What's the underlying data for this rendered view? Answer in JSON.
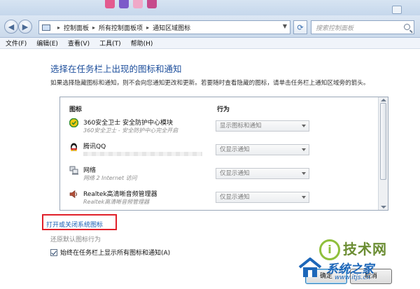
{
  "address_bar": {
    "breadcrumbs": [
      "控制面板",
      "所有控制面板项",
      "通知区域图标"
    ],
    "search_placeholder": "搜索控制面板"
  },
  "menu": [
    "文件(F)",
    "编辑(E)",
    "查看(V)",
    "工具(T)",
    "帮助(H)"
  ],
  "main": {
    "title": "选择在任务栏上出现的图标和通知",
    "description": "如果选择隐藏图标和通知，则不会向您通知更改和更新。若要随时查看隐藏的图标，请单击任务栏上通知区域旁的箭头。",
    "columns": {
      "icons": "图标",
      "behavior": "行为"
    },
    "rows": [
      {
        "name": "360安全卫士 安全防护中心模块",
        "sub": "360安全卫士 - 安全防护中心完全开启",
        "behavior": "显示图标和通知",
        "icon": "shield-icon"
      },
      {
        "name": "腾讯QQ",
        "sub": "",
        "behavior": "仅显示通知",
        "icon": "qq-penguin-icon"
      },
      {
        "name": "网络",
        "sub": "网络 2 Internet 访问",
        "behavior": "仅显示通知",
        "icon": "network-icon"
      },
      {
        "name": "Realtek高清晰音频管理器",
        "sub": "Realtek高清晰音频管理器",
        "behavior": "仅显示通知",
        "icon": "speaker-icon"
      }
    ],
    "link_open": "打开或关闭系统图标",
    "link_restore": "还原默认图标行为",
    "checkbox_label": "始终在任务栏上显示所有图标和通知(A)",
    "checkbox_checked": true
  },
  "buttons": {
    "ok": "确定",
    "cancel": "取消"
  },
  "watermark": {
    "line1": "技术网",
    "line2": "系统之家",
    "url": "www.itjs.cn"
  }
}
